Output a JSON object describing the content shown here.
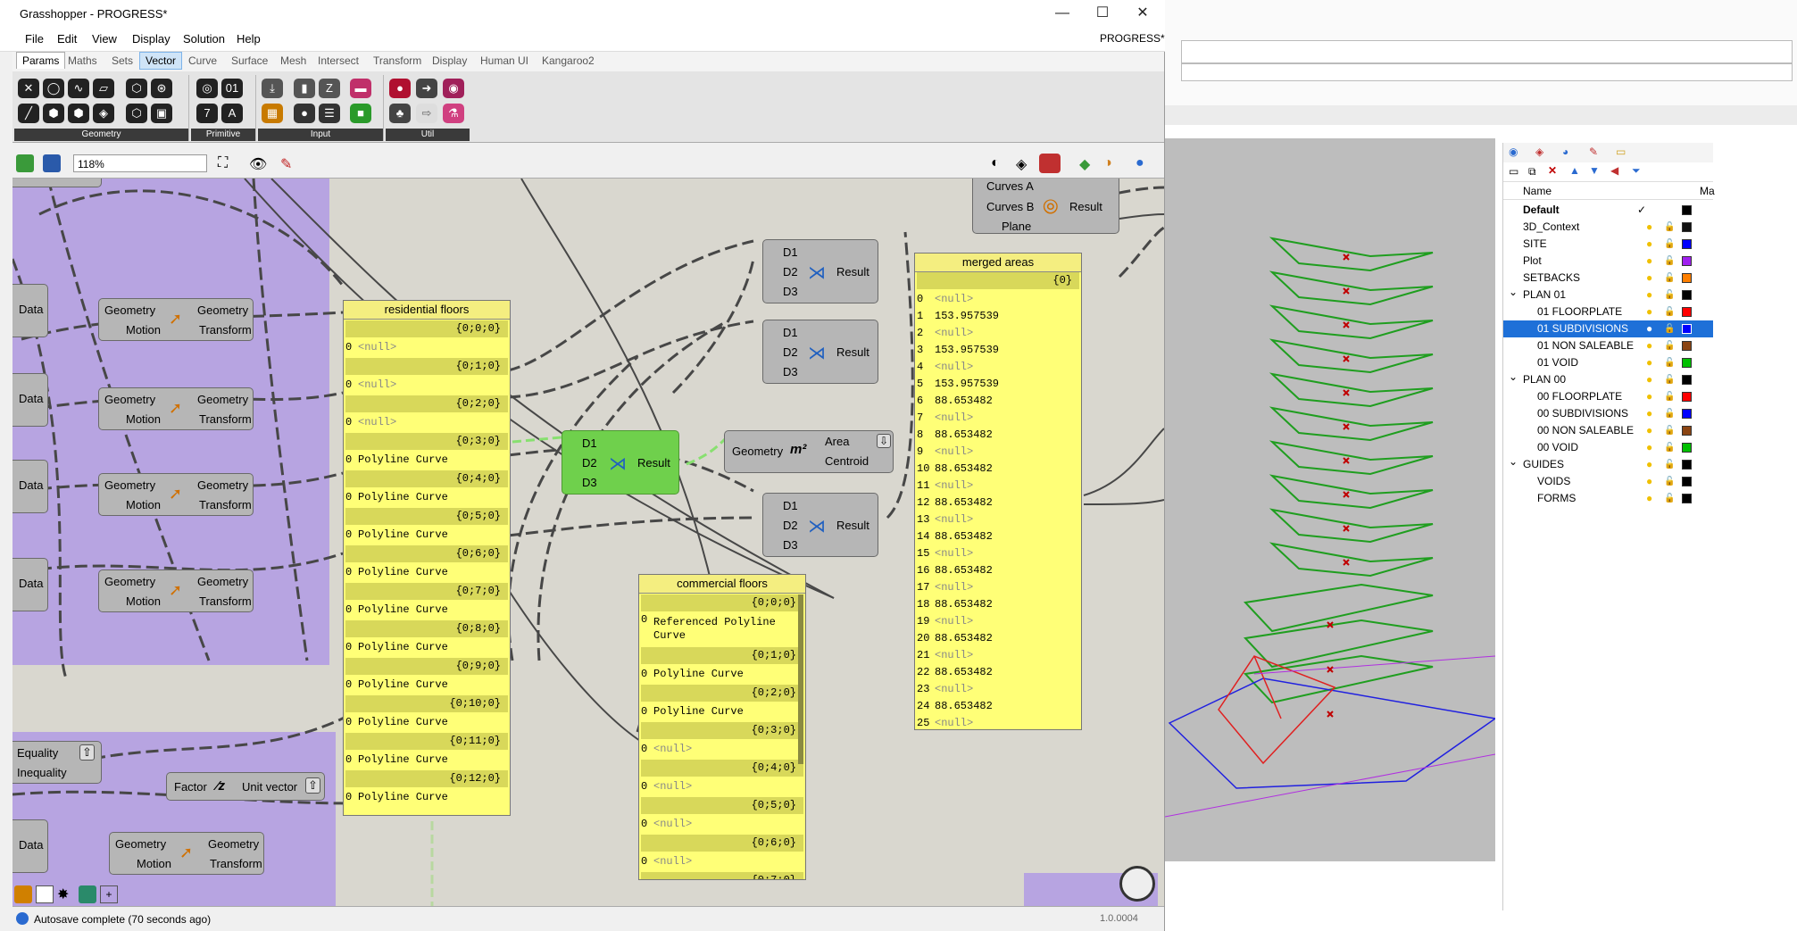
{
  "window": {
    "title": "Grasshopper - PROGRESS*",
    "doc_label": "PROGRESS*",
    "minimize": "—",
    "maximize": "☐",
    "close": "✕"
  },
  "menu": [
    "File",
    "Edit",
    "View",
    "Display",
    "Solution",
    "Help"
  ],
  "tabs": [
    "Params",
    "Maths",
    "Sets",
    "Vector",
    "Curve",
    "Surface",
    "Mesh",
    "Intersect",
    "Transform",
    "Display",
    "Human UI",
    "Kangaroo2"
  ],
  "ribbon_panels": [
    "Geometry",
    "Primitive",
    "Input",
    "Util"
  ],
  "zoom": "118%",
  "status": {
    "message": "Autosave complete (70 seconds ago)",
    "version": "1.0.0004"
  },
  "components": {
    "data_label": "Data",
    "motion": {
      "in": "Geometry",
      "in2": "Motion",
      "out": "Geometry",
      "out2": "Transform"
    },
    "curves": {
      "a": "Curves A",
      "b": "Curves B",
      "c": "Plane",
      "out": "Result"
    },
    "merge": {
      "d1": "D1",
      "d2": "D2",
      "d3": "D3",
      "out": "Result"
    },
    "area": {
      "in": "Geometry",
      "out1": "Area",
      "out2": "Centroid"
    },
    "equality": {
      "a": "Equality",
      "b": "Inequality"
    },
    "unitz": {
      "in": "Factor",
      "out": "Unit vector"
    }
  },
  "panels": {
    "residential": {
      "title": "residential floors",
      "rows": [
        {
          "path": "{0;0;0}",
          "i": "0",
          "v": "<null>"
        },
        {
          "path": "{0;1;0}",
          "i": "0",
          "v": "<null>"
        },
        {
          "path": "{0;2;0}",
          "i": "0",
          "v": "<null>"
        },
        {
          "path": "{0;3;0}",
          "i": "0",
          "v": "Polyline Curve"
        },
        {
          "path": "{0;4;0}",
          "i": "0",
          "v": "Polyline Curve"
        },
        {
          "path": "{0;5;0}",
          "i": "0",
          "v": "Polyline Curve"
        },
        {
          "path": "{0;6;0}",
          "i": "0",
          "v": "Polyline Curve"
        },
        {
          "path": "{0;7;0}",
          "i": "0",
          "v": "Polyline Curve"
        },
        {
          "path": "{0;8;0}",
          "i": "0",
          "v": "Polyline Curve"
        },
        {
          "path": "{0;9;0}",
          "i": "0",
          "v": "Polyline Curve"
        },
        {
          "path": "{0;10;0}",
          "i": "0",
          "v": "Polyline Curve"
        },
        {
          "path": "{0;11;0}",
          "i": "0",
          "v": "Polyline Curve"
        },
        {
          "path": "{0;12;0}",
          "i": "0",
          "v": "Polyline Curve"
        }
      ]
    },
    "commercial": {
      "title": "commercial floors",
      "rows": [
        {
          "path": "{0;0;0}",
          "i": "0",
          "v": "Referenced Polyline Curve"
        },
        {
          "path": "{0;1;0}",
          "i": "0",
          "v": "Polyline Curve"
        },
        {
          "path": "{0;2;0}",
          "i": "0",
          "v": "Polyline Curve"
        },
        {
          "path": "{0;3;0}",
          "i": "0",
          "v": "<null>"
        },
        {
          "path": "{0;4;0}",
          "i": "0",
          "v": "<null>"
        },
        {
          "path": "{0;5;0}",
          "i": "0",
          "v": "<null>"
        },
        {
          "path": "{0;6;0}",
          "i": "0",
          "v": "<null>"
        },
        {
          "path": "{0;7;0}",
          "i": "",
          "v": ""
        }
      ]
    },
    "merged": {
      "title": "merged areas",
      "path": "{0}",
      "values": [
        "<null>",
        "153.957539",
        "<null>",
        "153.957539",
        "<null>",
        "153.957539",
        "88.653482",
        "<null>",
        "88.653482",
        "<null>",
        "88.653482",
        "<null>",
        "88.653482",
        "<null>",
        "88.653482",
        "<null>",
        "88.653482",
        "<null>",
        "88.653482",
        "<null>",
        "88.653482",
        "<null>",
        "88.653482",
        "<null>",
        "88.653482",
        "<null>"
      ]
    }
  },
  "layers": {
    "header": "Name",
    "header2": "Ma",
    "rows": [
      {
        "name": "Default",
        "bold": true,
        "check": "✓",
        "color": "#000000",
        "indent": 0
      },
      {
        "name": "3D_Context",
        "color": "#111111",
        "indent": 0
      },
      {
        "name": "SITE",
        "color": "#0000ff",
        "indent": 0
      },
      {
        "name": "Plot",
        "color": "#a020f0",
        "indent": 0
      },
      {
        "name": "SETBACKS",
        "color": "#ff7f00",
        "indent": 0
      },
      {
        "name": "PLAN 01",
        "color": "#000000",
        "indent": 0,
        "expander": "⌄"
      },
      {
        "name": "01 FLOORPLATE",
        "color": "#ff0000",
        "indent": 1
      },
      {
        "name": "01 SUBDIVISIONS",
        "color": "#0000ff",
        "indent": 1,
        "selected": true
      },
      {
        "name": "01 NON SALEABLE",
        "color": "#8b4513",
        "indent": 1
      },
      {
        "name": "01 VOID",
        "color": "#00c000",
        "indent": 1
      },
      {
        "name": "PLAN 00",
        "color": "#000000",
        "indent": 0,
        "expander": "⌄"
      },
      {
        "name": "00 FLOORPLATE",
        "color": "#ff0000",
        "indent": 1
      },
      {
        "name": "00 SUBDIVISIONS",
        "color": "#0000ff",
        "indent": 1
      },
      {
        "name": "00 NON SALEABLE",
        "color": "#8b4513",
        "indent": 1
      },
      {
        "name": "00 VOID",
        "color": "#00c000",
        "indent": 1
      },
      {
        "name": "GUIDES",
        "color": "#000000",
        "indent": 0,
        "expander": "⌄"
      },
      {
        "name": "VOIDS",
        "color": "#000000",
        "indent": 1
      },
      {
        "name": "FORMS",
        "color": "#000000",
        "indent": 1
      }
    ]
  },
  "colors": {
    "group": "#b7a4e1",
    "panel": "#ffff77",
    "canvas": "#d9d7cf",
    "selected_layer": "#1e70d8"
  }
}
